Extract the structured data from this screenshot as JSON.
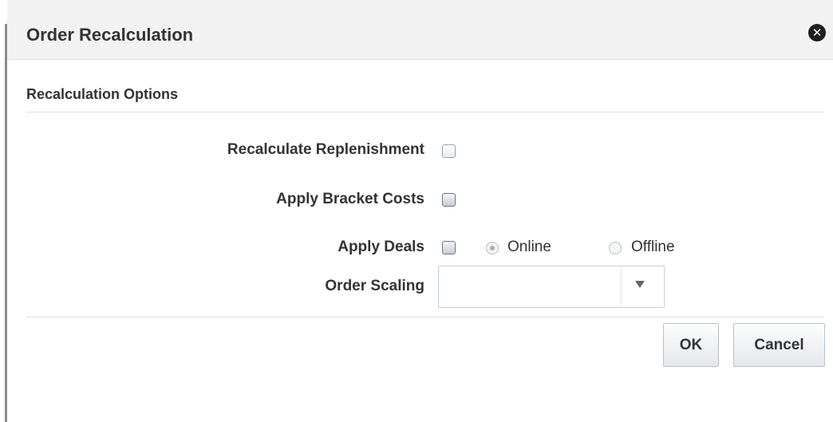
{
  "dialog": {
    "title": "Order Recalculation",
    "close_icon": "close-circle-icon"
  },
  "section": {
    "title": "Recalculation Options"
  },
  "options": {
    "recalculate_replenishment": {
      "label": "Recalculate Replenishment",
      "checked": false
    },
    "apply_bracket_costs": {
      "label": "Apply Bracket Costs",
      "checked": false
    },
    "apply_deals": {
      "label": "Apply Deals",
      "checked": false,
      "radio_options": [
        {
          "label": "Online",
          "selected": true
        },
        {
          "label": "Offline",
          "selected": false
        }
      ]
    },
    "order_scaling": {
      "label": "Order Scaling",
      "value": ""
    }
  },
  "buttons": {
    "ok": "OK",
    "cancel": "Cancel"
  }
}
